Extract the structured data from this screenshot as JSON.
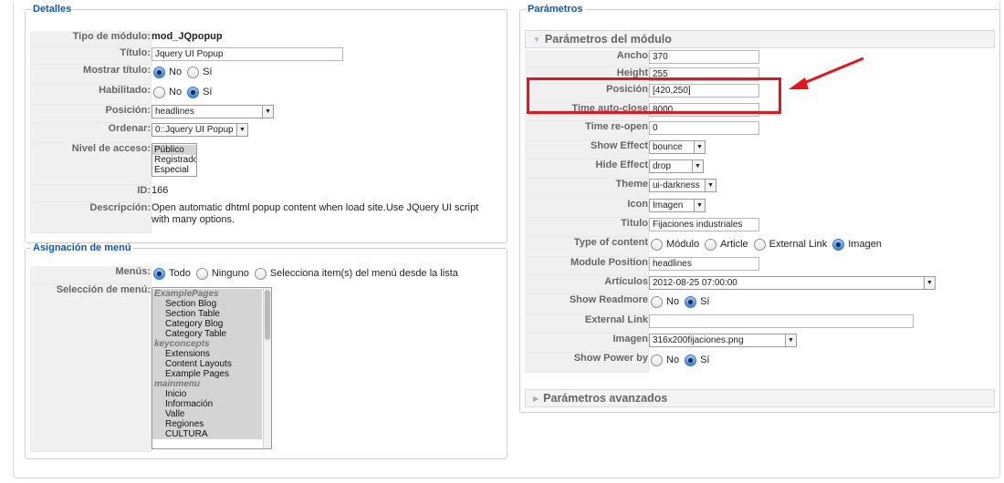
{
  "detalles": {
    "legend": "Detalles",
    "rows": {
      "tipo": {
        "label": "Tipo de módulo:",
        "value": "mod_JQpopup"
      },
      "titulo": {
        "label": "Título:",
        "value": "Jquery UI Popup"
      },
      "mostrar": {
        "label": "Mostrar título:",
        "opt_no": "No",
        "opt_si": "Sí",
        "selected": "No"
      },
      "habilitado": {
        "label": "Habilitado:",
        "opt_no": "No",
        "opt_si": "Sí",
        "selected": "Sí"
      },
      "posicion": {
        "label": "Posición:",
        "value": "headlines"
      },
      "ordenar": {
        "label": "Ordenar:",
        "value": "0::Jquery UI Popup"
      },
      "nivel": {
        "label": "Nivel de acceso:",
        "options": [
          "Público",
          "Registrado",
          "Especial"
        ],
        "selected": "Público"
      },
      "id": {
        "label": "ID:",
        "value": "166"
      },
      "descripcion": {
        "label": "Descripción:",
        "value": "Open automatic dhtml popup content when load site.Use JQuery UI script with many options."
      }
    }
  },
  "asignacion": {
    "legend": "Asignación de menú",
    "menus": {
      "label": "Menús:",
      "opt_todo": "Todo",
      "opt_ninguno": "Ninguno",
      "opt_selecciona": "Selecciona item(s) del menú desde la lista",
      "selected": "Todo"
    },
    "seleccion": {
      "label": "Selección de menú:",
      "groups": [
        {
          "name": "ExamplePages",
          "items": [
            "Section Blog",
            "Section Table",
            "Category Blog",
            "Category Table"
          ]
        },
        {
          "name": "keyconcepts",
          "items": [
            "Extensions",
            "Content Layouts",
            "Example Pages"
          ]
        },
        {
          "name": "mainmenu",
          "items": [
            "Inicio",
            "Información",
            "Valle",
            "Regiones",
            "CULTURA"
          ]
        }
      ]
    }
  },
  "parametros": {
    "legend": "Parámetros",
    "modulo_header": "Parámetros del módulo",
    "avanzados_header": "Parámetros avanzados",
    "rows": {
      "ancho": {
        "label": "Ancho",
        "value": "370"
      },
      "height": {
        "label": "Height",
        "value": "255"
      },
      "posicion": {
        "label": "Posición",
        "value": "[420,250]"
      },
      "autoclose": {
        "label": "Time auto-close",
        "value": "8000"
      },
      "reopen": {
        "label": "Time re-open",
        "value": "0"
      },
      "show_effect": {
        "label": "Show Effect",
        "value": "bounce"
      },
      "hide_effect": {
        "label": "Hide Effect",
        "value": "drop"
      },
      "theme": {
        "label": "Theme",
        "value": "ui-darkness"
      },
      "icon": {
        "label": "Icon",
        "value": "Imagen"
      },
      "titulo": {
        "label": "Titulo",
        "value": "Fijaciones industriales"
      },
      "type_content": {
        "label": "Type of content",
        "opt_modulo": "Módulo",
        "opt_article": "Article",
        "opt_external": "External Link",
        "opt_imagen": "Imagen",
        "selected": "Imagen"
      },
      "module_position": {
        "label": "Module Position",
        "value": "headlines"
      },
      "articulos": {
        "label": "Artículos",
        "value": "2012-08-25 07:00:00"
      },
      "readmore": {
        "label": "Show Readmore",
        "opt_no": "No",
        "opt_si": "Sí",
        "selected": "Sí"
      },
      "external_link": {
        "label": "External Link",
        "value": ""
      },
      "imagen": {
        "label": "Imagen",
        "value": "316x200fijaciones.png"
      },
      "power_by": {
        "label": "Show Power by",
        "opt_no": "No",
        "opt_si": "Sí",
        "selected": "Sí"
      }
    }
  },
  "annotation": {
    "highlight_color": "#e8141c",
    "arrow_color": "#e8141c"
  }
}
